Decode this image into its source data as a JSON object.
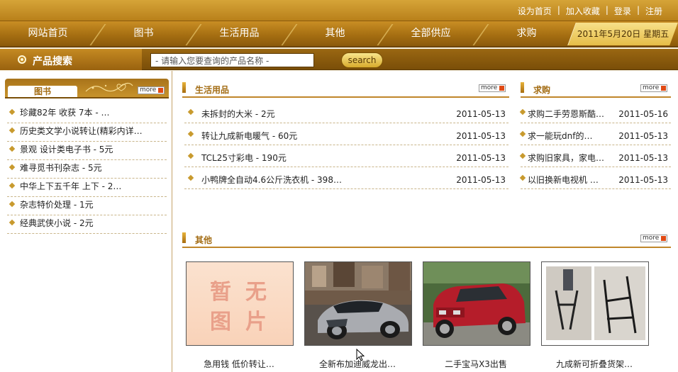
{
  "toplinks": {
    "home": "设为首页",
    "fav": "加入收藏",
    "login": "登录",
    "register": "注册"
  },
  "nav": {
    "items": [
      {
        "label": "网站首页"
      },
      {
        "label": "图书"
      },
      {
        "label": "生活用品"
      },
      {
        "label": "其他"
      },
      {
        "label": "全部供应"
      },
      {
        "label": "求购"
      }
    ],
    "date": "2011年5月20日  星期五"
  },
  "search": {
    "title": "产品搜索",
    "placeholder": "- 请输入您要查询的产品名称 -",
    "button": "search"
  },
  "more_label": "more",
  "sidebar": {
    "tab": "图书",
    "items": [
      {
        "label": "珍藏82年 收获 7本 - …"
      },
      {
        "label": "历史类文学小说转让(精彩内详…"
      },
      {
        "label": "景观 设计类电子书 - 5元"
      },
      {
        "label": "难寻觅书刊杂志 - 5元"
      },
      {
        "label": "中华上下五千年 上下 - 2…"
      },
      {
        "label": "杂志特价处理 - 1元"
      },
      {
        "label": "经典武侠小说 - 2元"
      }
    ]
  },
  "daily": {
    "title": "生活用品",
    "items": [
      {
        "label": "未拆封的大米 - 2元",
        "date": "2011-05-13"
      },
      {
        "label": "转让九成新电暖气 - 60元",
        "date": "2011-05-13"
      },
      {
        "label": "TCL25寸彩电 - 190元",
        "date": "2011-05-13"
      },
      {
        "label": "小鸭牌全自动4.6公斤洗衣机 - 398…",
        "date": "2011-05-13"
      }
    ]
  },
  "buy": {
    "title": "求购",
    "items": [
      {
        "label": "求购二手劳恩斯酷…",
        "date": "2011-05-16"
      },
      {
        "label": "求一能玩dnf的…",
        "date": "2011-05-13"
      },
      {
        "label": "求购旧家具，家电…",
        "date": "2011-05-13"
      },
      {
        "label": "以旧换新电视机 …",
        "date": "2011-05-13"
      }
    ]
  },
  "other": {
    "title": "其他",
    "noimage": "暂无图片",
    "items": [
      {
        "caption": "急用钱 低价转让…"
      },
      {
        "caption": "全新布加迪威龙出…"
      },
      {
        "caption": "二手宝马X3出售"
      },
      {
        "caption": "九成新可折叠货架…"
      }
    ]
  }
}
